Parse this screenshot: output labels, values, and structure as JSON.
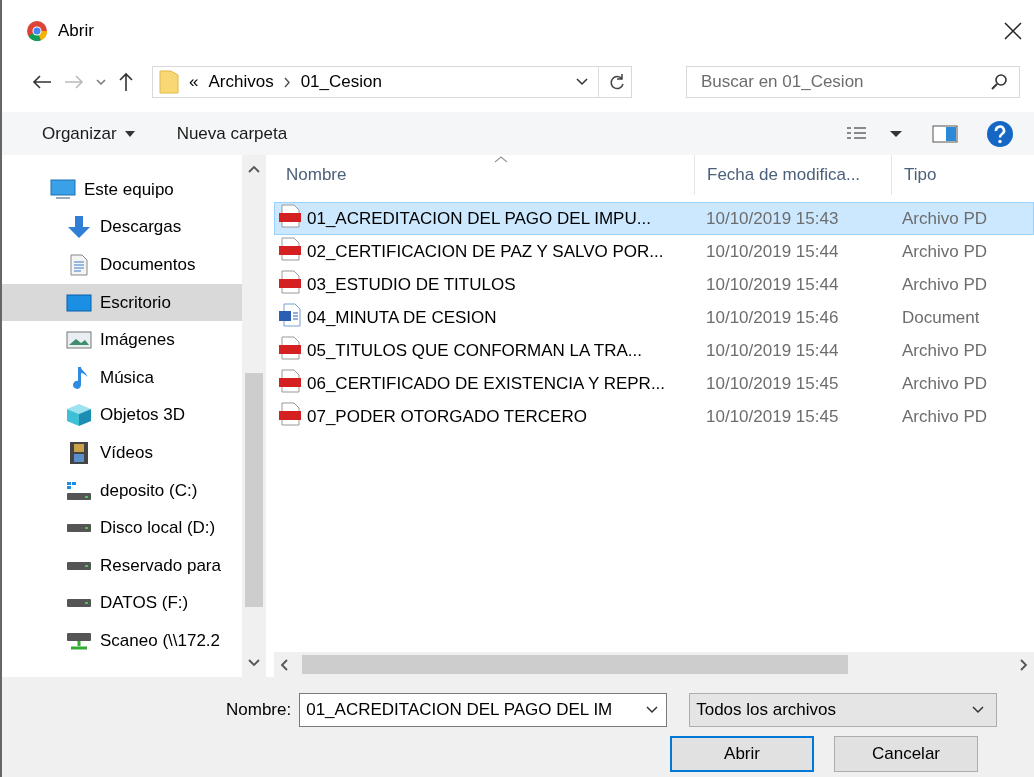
{
  "window": {
    "title": "Abrir"
  },
  "address_bar": {
    "overflow": "«",
    "path": [
      "Archivos",
      "01_Cesion"
    ]
  },
  "search": {
    "placeholder": "Buscar en 01_Cesion"
  },
  "toolbar": {
    "organize": "Organizar",
    "new_folder": "Nueva carpeta"
  },
  "sidebar": {
    "items": [
      {
        "label": "Este equipo",
        "kind": "computer",
        "selected": false,
        "children": [
          {
            "label": "Descargas",
            "kind": "download",
            "selected": false
          },
          {
            "label": "Documentos",
            "kind": "documents",
            "selected": false
          },
          {
            "label": "Escritorio",
            "kind": "desktop",
            "selected": true
          },
          {
            "label": "Imágenes",
            "kind": "pictures",
            "selected": false
          },
          {
            "label": "Música",
            "kind": "music",
            "selected": false
          },
          {
            "label": "Objetos 3D",
            "kind": "cube",
            "selected": false
          },
          {
            "label": "Vídeos",
            "kind": "videos",
            "selected": false
          },
          {
            "label": "deposito (C:)",
            "kind": "system-drive",
            "selected": false
          },
          {
            "label": "Disco local (D:)",
            "kind": "drive",
            "selected": false
          },
          {
            "label": "Reservado para",
            "kind": "drive",
            "selected": false
          },
          {
            "label": "DATOS (F:)",
            "kind": "drive",
            "selected": false
          },
          {
            "label": "Scaneo (\\\\172.2",
            "kind": "network-drive",
            "selected": false
          }
        ]
      }
    ]
  },
  "table": {
    "columns": [
      "Nombre",
      "Fecha de modifica...",
      "Tipo"
    ],
    "rows": [
      {
        "kind": "pdf",
        "name": "01_ACREDITACION DEL PAGO DEL IMPU...",
        "date": "10/10/2019 15:43",
        "type": "Archivo PD",
        "selected": true
      },
      {
        "kind": "pdf",
        "name": "02_CERTIFICACION DE PAZ Y SALVO POR...",
        "date": "10/10/2019 15:44",
        "type": "Archivo PD",
        "selected": false
      },
      {
        "kind": "pdf",
        "name": "03_ESTUDIO DE TITULOS",
        "date": "10/10/2019 15:44",
        "type": "Archivo PD",
        "selected": false
      },
      {
        "kind": "word",
        "name": "04_MINUTA DE CESION",
        "date": "10/10/2019 15:46",
        "type": "Document",
        "selected": false
      },
      {
        "kind": "pdf",
        "name": "05_TITULOS QUE CONFORMAN LA TRA...",
        "date": "10/10/2019 15:44",
        "type": "Archivo PD",
        "selected": false
      },
      {
        "kind": "pdf",
        "name": "06_CERTIFICADO DE EXISTENCIA Y REPR...",
        "date": "10/10/2019 15:45",
        "type": "Archivo PD",
        "selected": false
      },
      {
        "kind": "pdf",
        "name": "07_PODER OTORGADO TERCERO",
        "date": "10/10/2019 15:45",
        "type": "Archivo PD",
        "selected": false
      }
    ]
  },
  "footer": {
    "name_label": "Nombre:",
    "name_value": "01_ACREDITACION DEL PAGO DEL IM",
    "filter": "Todos los archivos",
    "open_button": "Abrir",
    "cancel_button": "Cancelar"
  }
}
